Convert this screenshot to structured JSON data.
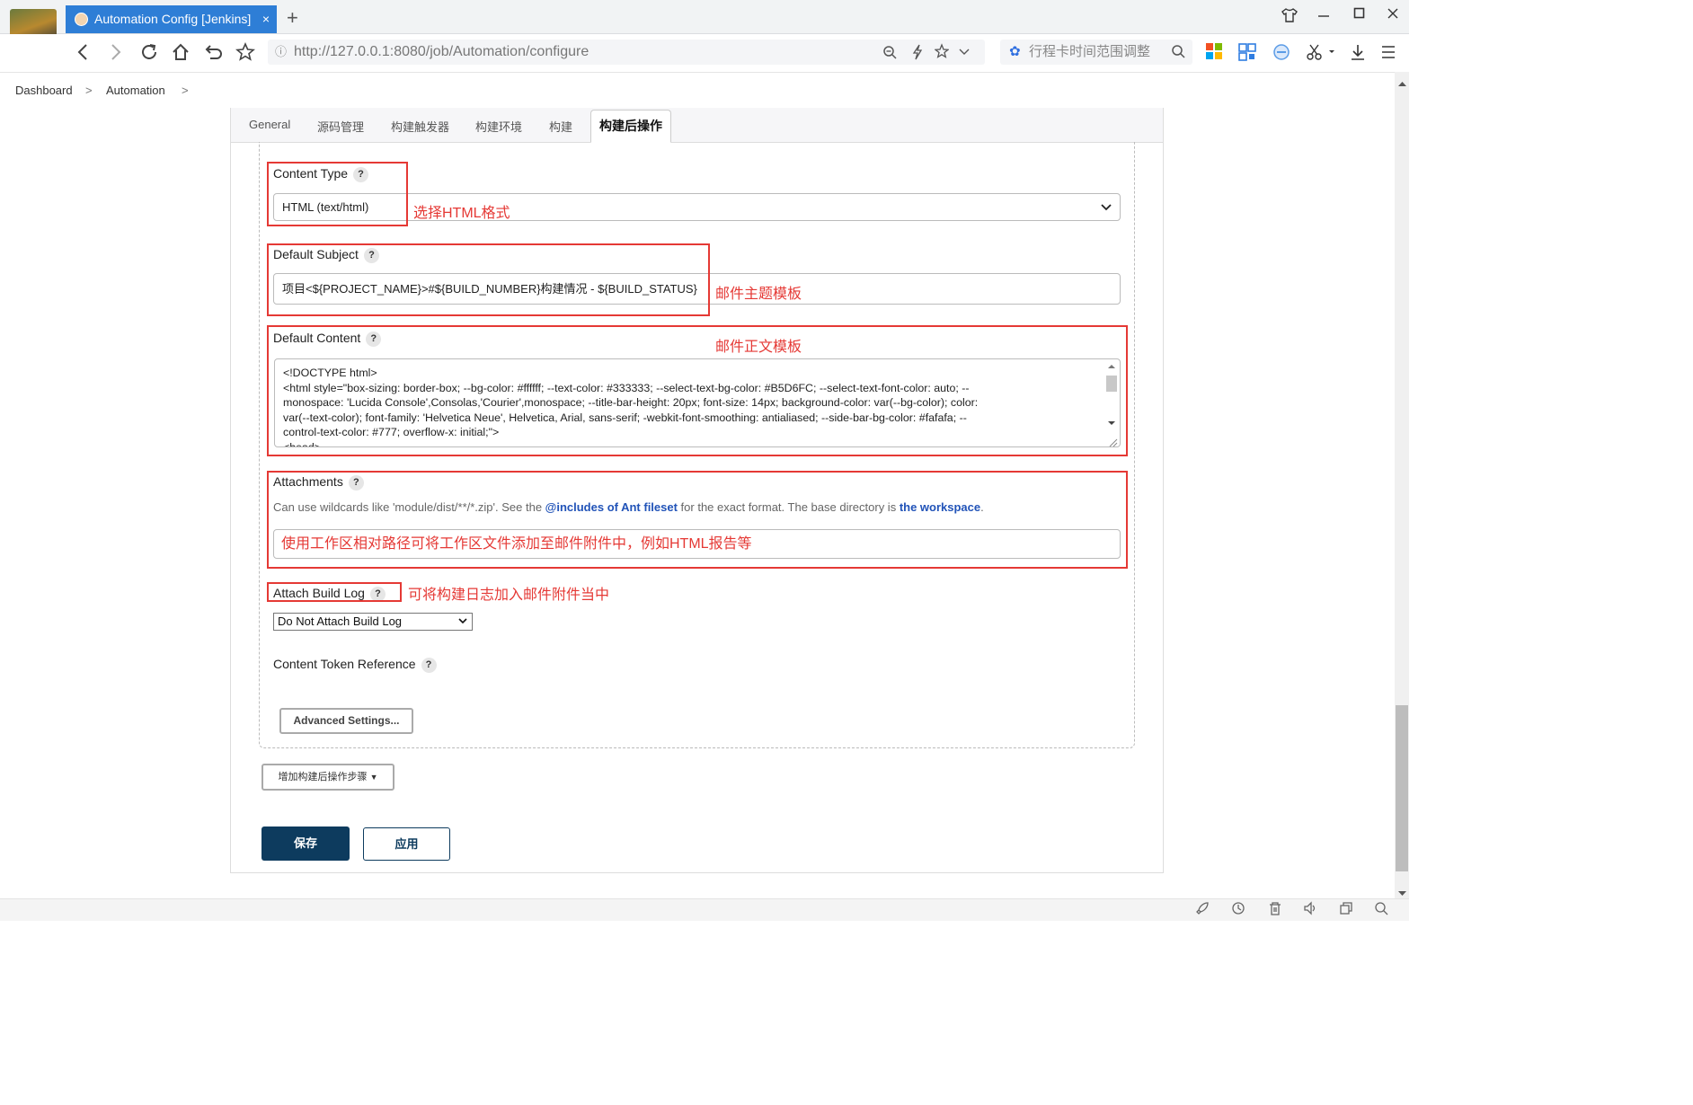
{
  "browser": {
    "tab_title": "Automation Config [Jenkins]",
    "tab_close": "×",
    "new_tab": "+",
    "url_host": "http://127.0.0.1",
    "url_path": ":8080/job/Automation/configure",
    "search_text": "行程卡时间范围调整"
  },
  "breadcrumb": {
    "items": [
      "Dashboard",
      "Automation"
    ],
    "separator": ">"
  },
  "tabs": [
    "General",
    "源码管理",
    "构建触发器",
    "构建环境",
    "构建",
    "构建后操作"
  ],
  "active_tab": "构建后操作",
  "form": {
    "content_type_label": "Content Type",
    "content_type_value": "HTML (text/html)",
    "default_subject_label": "Default Subject",
    "default_subject_value": "项目<${PROJECT_NAME}>#${BUILD_NUMBER}构建情况 - ${BUILD_STATUS}",
    "default_content_label": "Default Content",
    "default_content_lines": [
      "<!DOCTYPE html>",
      "<html style=\"box-sizing: border-box; --bg-color: #ffffff; --text-color: #333333; --select-text-bg-color: #B5D6FC; --select-text-font-color: auto; --",
      "monospace: 'Lucida Console',Consolas,'Courier',monospace; --title-bar-height: 20px; font-size: 14px; background-color: var(--bg-color); color:",
      "var(--text-color); font-family: 'Helvetica Neue', Helvetica, Arial, sans-serif; -webkit-font-smoothing: antialiased; --side-bar-bg-color: #fafafa; --",
      "control-text-color: #777; overflow-x: initial;\">",
      "<head>"
    ],
    "attachments_label": "Attachments",
    "attachments_desc_1": "Can use wildcards like 'module/dist/**/*.zip'. See the ",
    "attachments_link_1": "@includes of Ant fileset",
    "attachments_desc_2": " for the exact format. The base directory is ",
    "attachments_link_2": "the workspace",
    "attachments_desc_3": ".",
    "attach_build_log_label": "Attach Build Log",
    "attach_build_log_value": "Do Not Attach Build Log",
    "content_token_label": "Content Token Reference",
    "help_glyph": "?",
    "advanced_settings": "Advanced Settings...",
    "add_post_build_step": "增加构建后操作步骤",
    "save": "保存",
    "apply": "应用"
  },
  "annotations": {
    "content_type": "选择HTML格式",
    "subject": "邮件主题模板",
    "content": "邮件正文模板",
    "attachments": "使用工作区相对路径可将工作区文件添加至邮件附件中，例如HTML报告等",
    "build_log": "可将构建日志加入邮件附件当中"
  },
  "colors": {
    "annotation_red": "#e53935",
    "tab_blue": "#2e7ed6",
    "save_bg": "#0d3b5e",
    "link_blue": "#2153b8"
  },
  "icons": {
    "back": "chevron-left-icon",
    "forward": "chevron-right-icon",
    "reload": "reload-icon",
    "home": "home-icon",
    "undo": "undo-icon",
    "bookmark": "star-icon"
  }
}
